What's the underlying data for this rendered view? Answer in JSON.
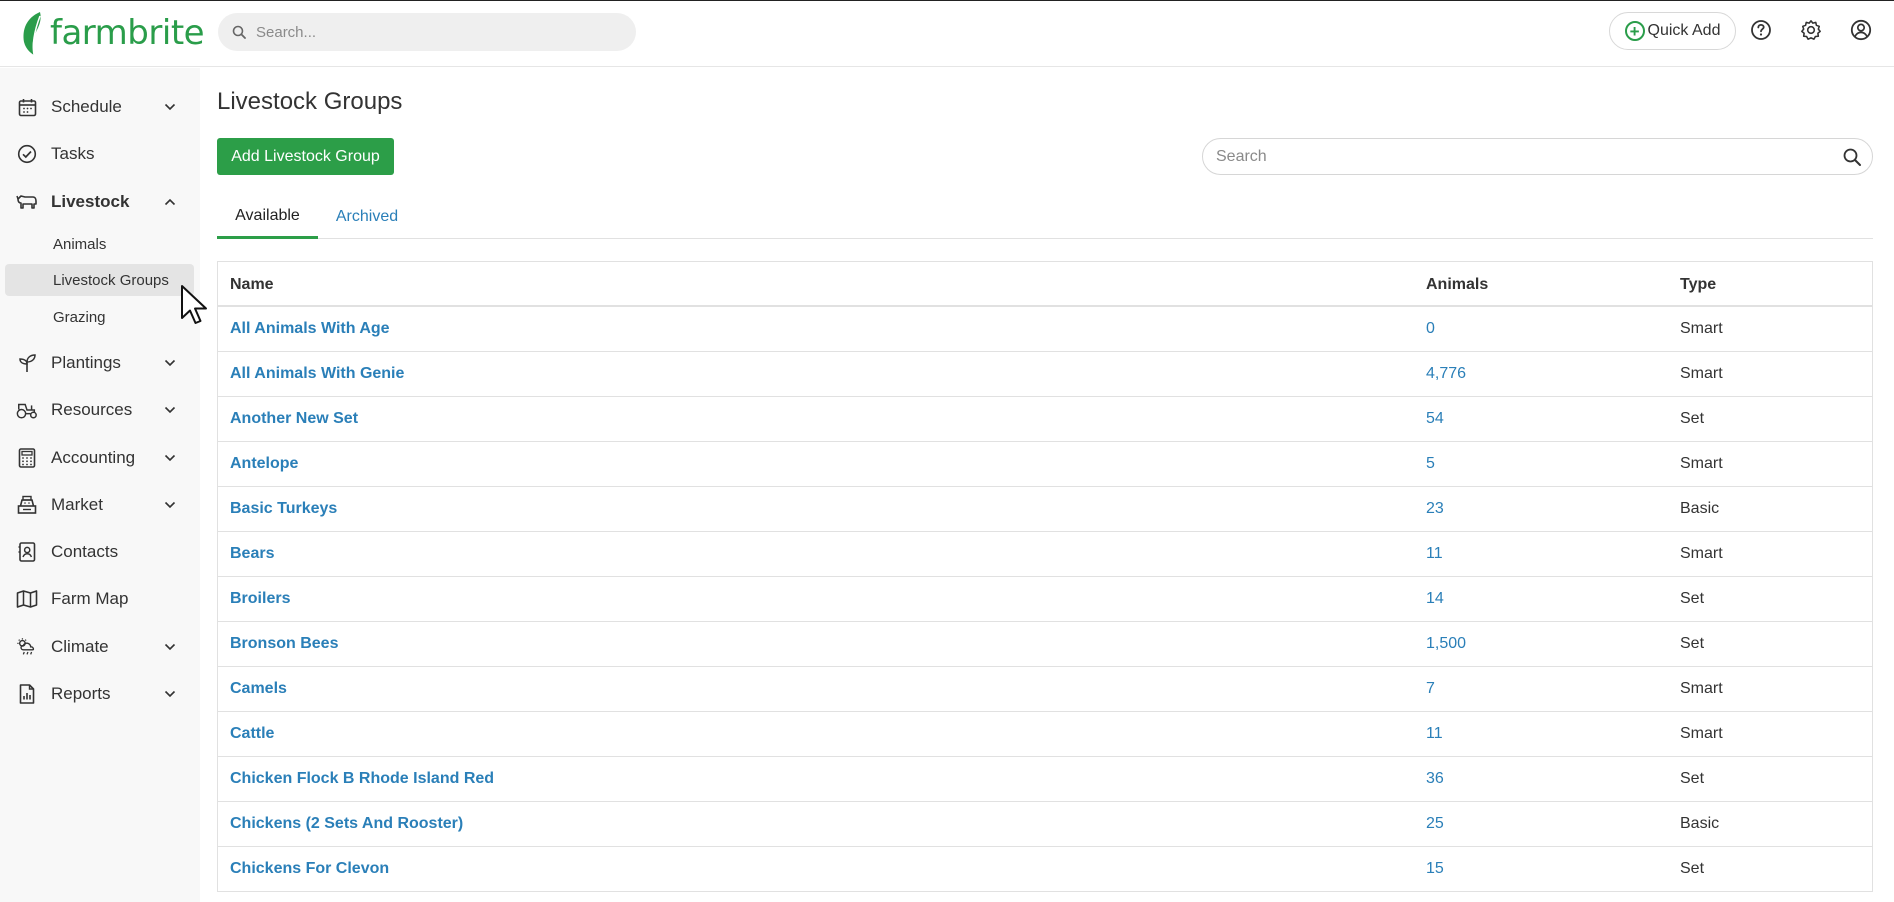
{
  "app": {
    "brand": "farmbrite",
    "brand_color": "#2a9d4a",
    "link_color": "#2a7fb8",
    "button_color": "#2c9e48"
  },
  "topbar": {
    "search_placeholder": "Search...",
    "quick_add_label": "Quick Add",
    "icons": [
      "help-icon",
      "gear-icon",
      "user-icon"
    ]
  },
  "sidebar": {
    "items": [
      {
        "label": "Schedule",
        "icon": "calendar-icon",
        "has_chevron": true
      },
      {
        "label": "Tasks",
        "icon": "check-circle-icon",
        "has_chevron": false
      },
      {
        "label": "Livestock",
        "icon": "livestock-icon",
        "has_chevron": true,
        "expanded": true
      },
      {
        "label": "Plantings",
        "icon": "sprout-icon",
        "has_chevron": true
      },
      {
        "label": "Resources",
        "icon": "tractor-icon",
        "has_chevron": true
      },
      {
        "label": "Accounting",
        "icon": "calculator-icon",
        "has_chevron": true
      },
      {
        "label": "Market",
        "icon": "register-icon",
        "has_chevron": true
      },
      {
        "label": "Contacts",
        "icon": "contact-card-icon",
        "has_chevron": false
      },
      {
        "label": "Farm Map",
        "icon": "map-icon",
        "has_chevron": false
      },
      {
        "label": "Climate",
        "icon": "weather-icon",
        "has_chevron": true
      },
      {
        "label": "Reports",
        "icon": "report-icon",
        "has_chevron": true
      }
    ],
    "livestock_sub": [
      {
        "label": "Animals",
        "active": false
      },
      {
        "label": "Livestock Groups",
        "active": true
      },
      {
        "label": "Grazing",
        "active": false
      }
    ]
  },
  "main": {
    "title": "Livestock Groups",
    "add_button_label": "Add Livestock Group",
    "search_placeholder": "Search",
    "tabs": [
      {
        "label": "Available",
        "active": true
      },
      {
        "label": "Archived",
        "active": false
      }
    ],
    "table": {
      "headers": {
        "name": "Name",
        "animals": "Animals",
        "type": "Type"
      },
      "rows": [
        {
          "name": "All Animals With Age",
          "animals": "0",
          "type": "Smart"
        },
        {
          "name": "All Animals With Genie",
          "animals": "4,776",
          "type": "Smart"
        },
        {
          "name": "Another New Set",
          "animals": "54",
          "type": "Set"
        },
        {
          "name": "Antelope",
          "animals": "5",
          "type": "Smart"
        },
        {
          "name": "Basic Turkeys",
          "animals": "23",
          "type": "Basic"
        },
        {
          "name": "Bears",
          "animals": "11",
          "type": "Smart"
        },
        {
          "name": "Broilers",
          "animals": "14",
          "type": "Set"
        },
        {
          "name": "Bronson Bees",
          "animals": "1,500",
          "type": "Set"
        },
        {
          "name": "Camels",
          "animals": "7",
          "type": "Smart"
        },
        {
          "name": "Cattle",
          "animals": "11",
          "type": "Smart"
        },
        {
          "name": "Chicken Flock B Rhode Island Red",
          "animals": "36",
          "type": "Set"
        },
        {
          "name": "Chickens (2 Sets And Rooster)",
          "animals": "25",
          "type": "Basic"
        },
        {
          "name": "Chickens For Clevon",
          "animals": "15",
          "type": "Set"
        }
      ]
    }
  }
}
